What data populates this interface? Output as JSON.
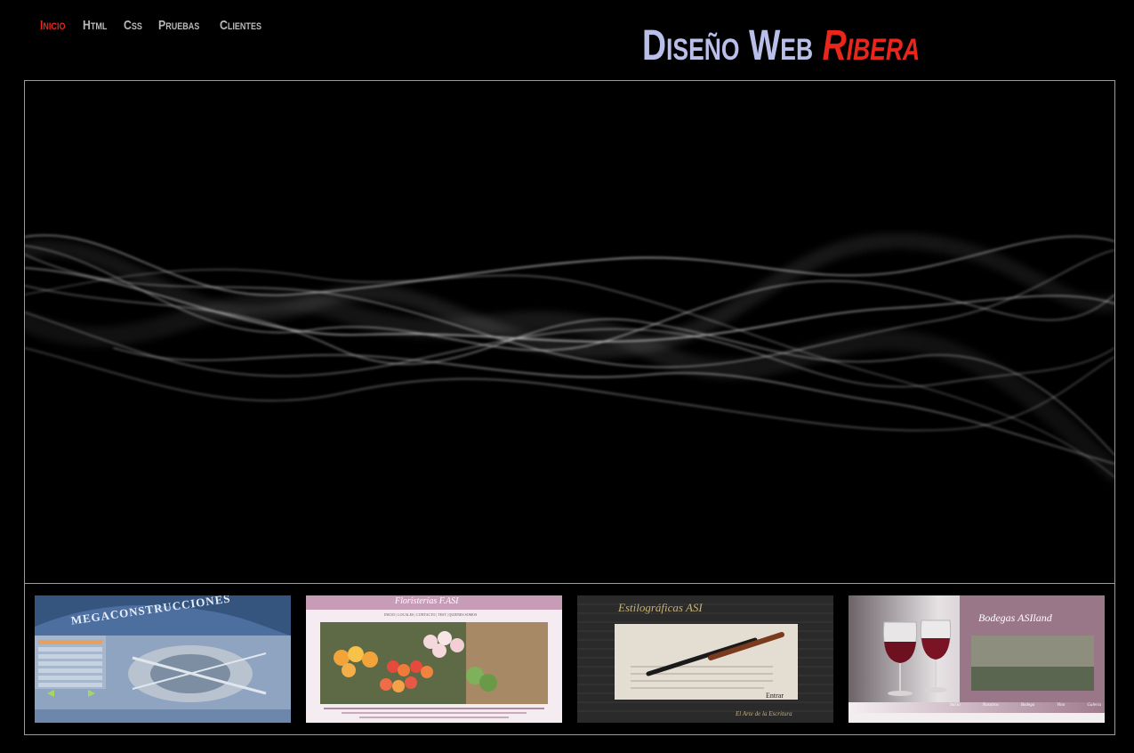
{
  "nav": {
    "items": [
      {
        "label": "Inicio",
        "active": true
      },
      {
        "label": "Html"
      },
      {
        "label": "Css"
      },
      {
        "label": "Pruebas"
      },
      {
        "label": "Clientes"
      }
    ]
  },
  "brand": {
    "word1": "Diseño",
    "word2": "Web",
    "word3": "Ribera"
  },
  "colors": {
    "background": "#000000",
    "nav_active": "#e8261c",
    "nav_default": "#b9b9b9",
    "brand_blue": "#b9bfe9",
    "brand_red": "#e8261c",
    "frame_border": "#9c9c9c"
  },
  "thumbs": {
    "t1": {
      "title": "MEGACONSTRUCCIONES"
    },
    "t2": {
      "title": "Floristerías F.ASI",
      "nav": "INICIO | LOCALES | CONTACTO | TEST | QUIENES SOMOS"
    },
    "t3": {
      "title": "Estilográficas ASI",
      "enter": "Entrar",
      "footer": "El Arte de la Escritura"
    },
    "t4": {
      "title": "Bodegas ASIland",
      "menu": [
        "Inicio",
        "Nosotros",
        "Bodega",
        "Vino",
        "Galeria"
      ]
    }
  }
}
